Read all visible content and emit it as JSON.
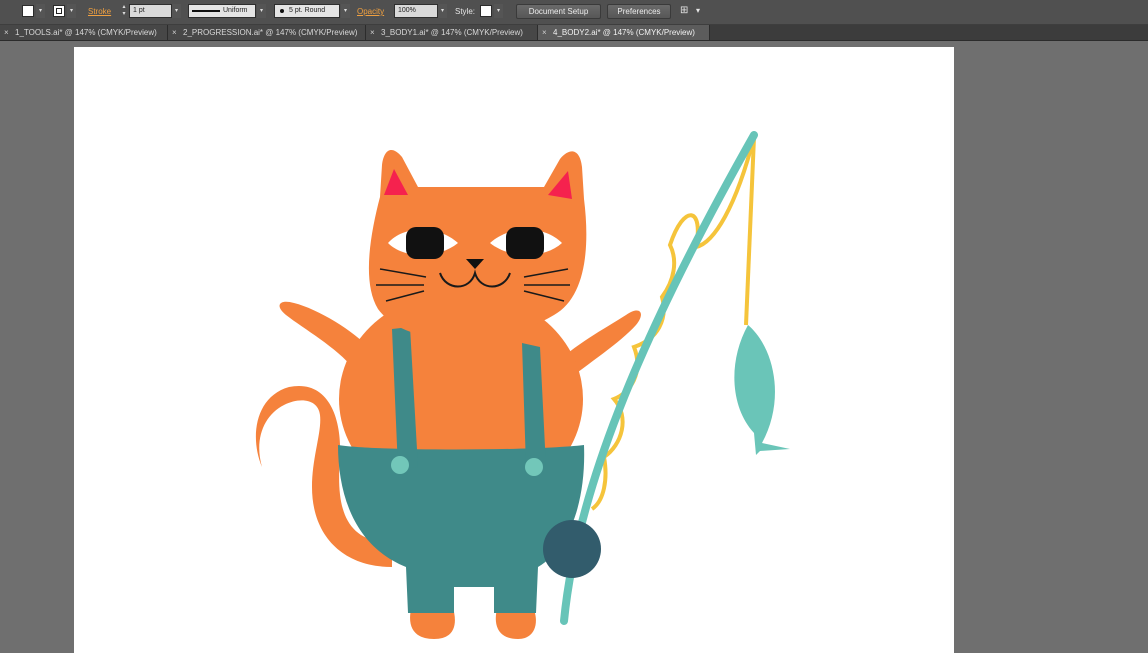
{
  "control_bar": {
    "stroke_label": "Stroke",
    "stroke_weight": "1 pt",
    "profile": "Uniform",
    "brush": "5 pt. Round",
    "opacity_label": "Opacity",
    "opacity_value": "100%",
    "style_label": "Style:",
    "document_setup": "Document Setup",
    "preferences": "Preferences",
    "arrow_glyph": "▾",
    "up_glyph": "▴",
    "arrange_glyph": "⊞"
  },
  "tabs": [
    {
      "label": "1_TOOLS.ai* @ 147% (CMYK/Preview)",
      "active": false
    },
    {
      "label": "2_PROGRESSION.ai* @ 147% (CMYK/Preview)",
      "active": false
    },
    {
      "label": "3_BODY1.ai* @ 147% (CMYK/Preview)",
      "active": false
    },
    {
      "label": "4_BODY2.ai* @ 147% (CMYK/Preview)",
      "active": true
    }
  ],
  "close_glyph": "×",
  "colors": {
    "cat_orange": "#f5823c",
    "ear_pink": "#f5224e",
    "overalls_teal": "#3f8a89",
    "button_mint": "#72c7b9",
    "rod_teal": "#67c4b8",
    "line_yellow": "#f5c43b",
    "fish_mint": "#6ac5b8",
    "reel_navy": "#325c6c",
    "eye_black": "#111111",
    "eye_white": "#ffffff",
    "whisker": "#1a1a1a"
  }
}
